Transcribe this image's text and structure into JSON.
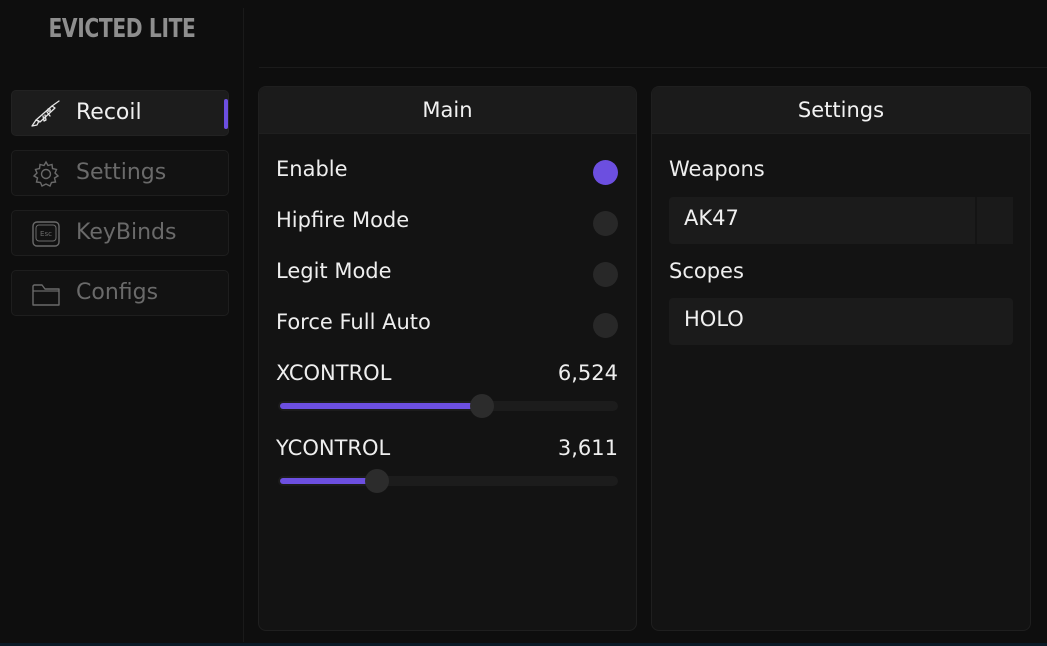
{
  "app": {
    "title": "EVICTED LITE"
  },
  "sidebar": {
    "items": [
      {
        "label": "Recoil",
        "icon": "rifle-icon",
        "active": true
      },
      {
        "label": "Settings",
        "icon": "gear-icon",
        "active": false
      },
      {
        "label": "KeyBinds",
        "icon": "esc-key-icon",
        "active": false
      },
      {
        "label": "Configs",
        "icon": "folder-icon",
        "active": false
      }
    ],
    "esc_key_text": "Esc"
  },
  "main_panel": {
    "title": "Main",
    "toggles": [
      {
        "label": "Enable",
        "on": true
      },
      {
        "label": "Hipfire Mode",
        "on": false
      },
      {
        "label": "Legit Mode",
        "on": false
      },
      {
        "label": "Force Full Auto",
        "on": false
      }
    ],
    "sliders": [
      {
        "label": "XCONTROL",
        "value": "6,524",
        "fraction": 0.6
      },
      {
        "label": "YCONTROL",
        "value": "3,611",
        "fraction": 0.29
      }
    ]
  },
  "settings_panel": {
    "title": "Settings",
    "weapons": {
      "label": "Weapons",
      "value": "AK47"
    },
    "scopes": {
      "label": "Scopes",
      "value": "HOLO"
    }
  },
  "colors": {
    "accent": "#6c4fe0",
    "background": "#0e0e0e",
    "panel": "#131313",
    "header": "#1b1b1b"
  }
}
